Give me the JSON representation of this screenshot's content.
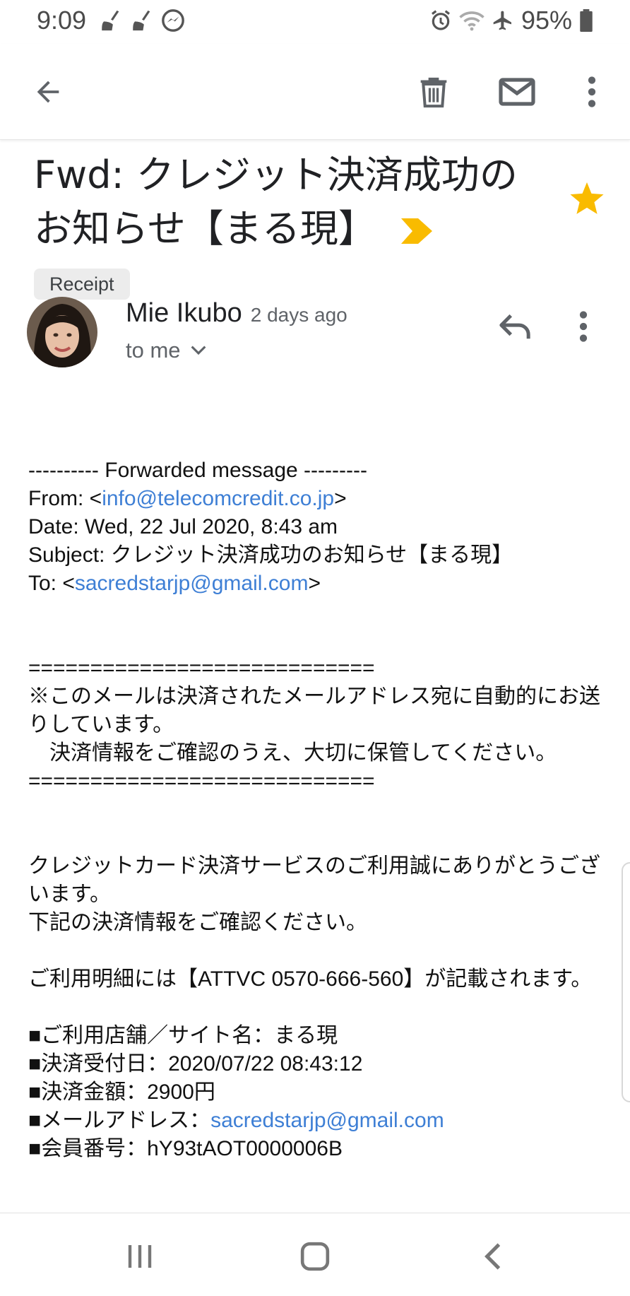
{
  "status_bar": {
    "time": "9:09",
    "left_icons": [
      "broom-icon",
      "broom-icon",
      "messenger-icon"
    ],
    "right_icons": [
      "alarm-icon",
      "wifi-icon",
      "airplane-icon",
      "battery-icon"
    ],
    "battery": "95%"
  },
  "app_bar": {
    "icons": [
      "back-arrow-icon",
      "trash-icon",
      "mail-icon",
      "more-vert-icon"
    ]
  },
  "email": {
    "subject": "Fwd: クレジット決済成功のお知らせ【まる現】",
    "label": "Receipt",
    "starred": true,
    "sender_name": "Mie Ikubo",
    "sent_time": "2 days ago",
    "recipient": "to me"
  },
  "body": {
    "forward_header": "---------- Forwarded message ---------",
    "from_prefix": "From: <",
    "from_email": "info@telecomcredit.co.jp",
    "from_suffix": ">",
    "date": "Date: Wed, 22 Jul 2020, 8:43 am",
    "subject": "Subject: クレジット決済成功のお知らせ【まる現】",
    "to_prefix": "To: <",
    "to_email": "sacredstarjp@gmail.com",
    "to_suffix": ">",
    "separator": "============================",
    "notice_1": "※このメールは決済されたメールアドレス宛に自動的にお送りしています。",
    "notice_2": "　決済情報をご確認のうえ、大切に保管してください。",
    "thanks": "クレジットカード決済サービスのご利用誠にありがとうございます。",
    "confirm": "下記の決済情報をご確認ください。",
    "statement": "ご利用明細には【ATTVC 0570-666-560】が記載されます。",
    "shop": "■ご利用店舗／サイト名：まる現",
    "payment_date": "■決済受付日：2020/07/22 08:43:12",
    "amount": "■決済金額：2900円",
    "email_label": "■メールアドレス：",
    "email_value": "sacredstarjp@gmail.com",
    "member_id": "■会員番号：hY93tAOT0000006B"
  },
  "colors": {
    "link": "#3e7fd5",
    "star": "#f9bb00",
    "importance": "#f9bb00",
    "chip_bg": "#ececec"
  }
}
